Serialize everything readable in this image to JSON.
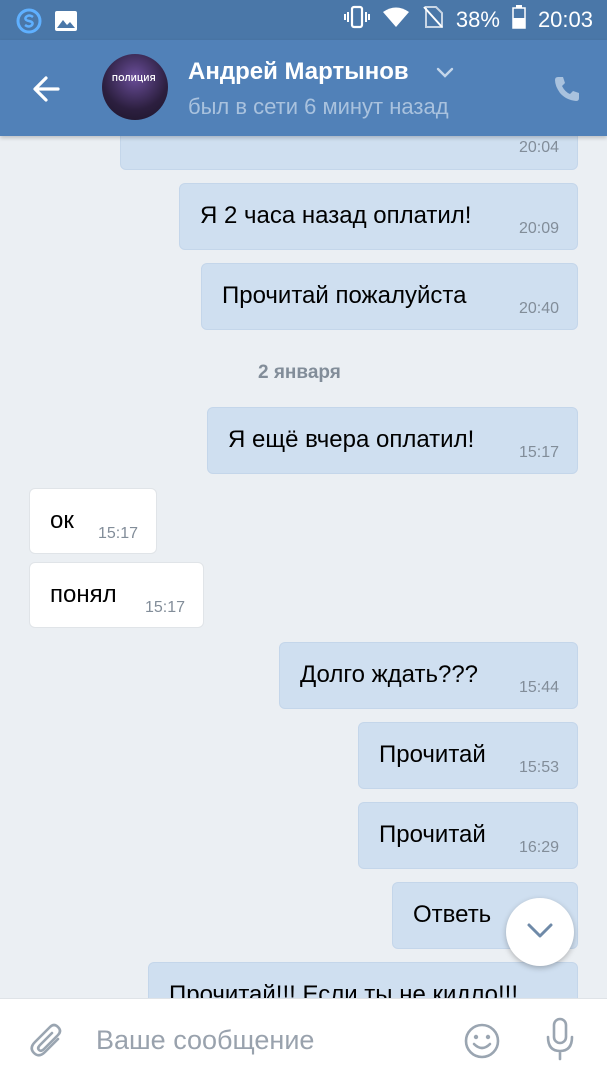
{
  "status_bar": {
    "battery": "38%",
    "time": "20:03",
    "left_icons": [
      "s-app-icon",
      "image-icon"
    ],
    "right_icons": [
      "vibrate-icon",
      "wifi-icon",
      "no-sim-icon",
      "battery-icon"
    ]
  },
  "header": {
    "contact_name": "Андрей Мартынов",
    "presence": "был в сети 6 минут назад",
    "avatar_text": "ПОЛИЦИЯ"
  },
  "messages": [
    {
      "dir": "out",
      "text": "",
      "time": "20:04"
    },
    {
      "dir": "out",
      "text": "Я 2 часа назад оплатил!",
      "time": "20:09"
    },
    {
      "dir": "out",
      "text": "Прочитай пожалуйста",
      "time": "20:40"
    },
    {
      "dir": "out",
      "text": "Я ещё вчера оплатил!",
      "time": "15:17"
    },
    {
      "dir": "in",
      "text": "ок",
      "time": "15:17"
    },
    {
      "dir": "in",
      "text": "понял",
      "time": "15:17"
    },
    {
      "dir": "out",
      "text": "Долго ждать???",
      "time": "15:44"
    },
    {
      "dir": "out",
      "text": "Прочитай",
      "time": "15:53"
    },
    {
      "dir": "out",
      "text": "Прочитай",
      "time": "16:29"
    },
    {
      "dir": "out",
      "text": "Ответь",
      "time": ""
    },
    {
      "dir": "out",
      "text": "Прочитай!!! Если ты не кидло!!!",
      "time": ""
    }
  ],
  "date_separator": "2 января",
  "composer": {
    "placeholder": "Ваше сообщение"
  },
  "colors": {
    "status_bar": "#4a77a8",
    "header": "#5181b8",
    "chat_bg": "#ebeff3",
    "outgoing_bubble": "#cfdff0",
    "incoming_bubble": "#ffffff"
  }
}
